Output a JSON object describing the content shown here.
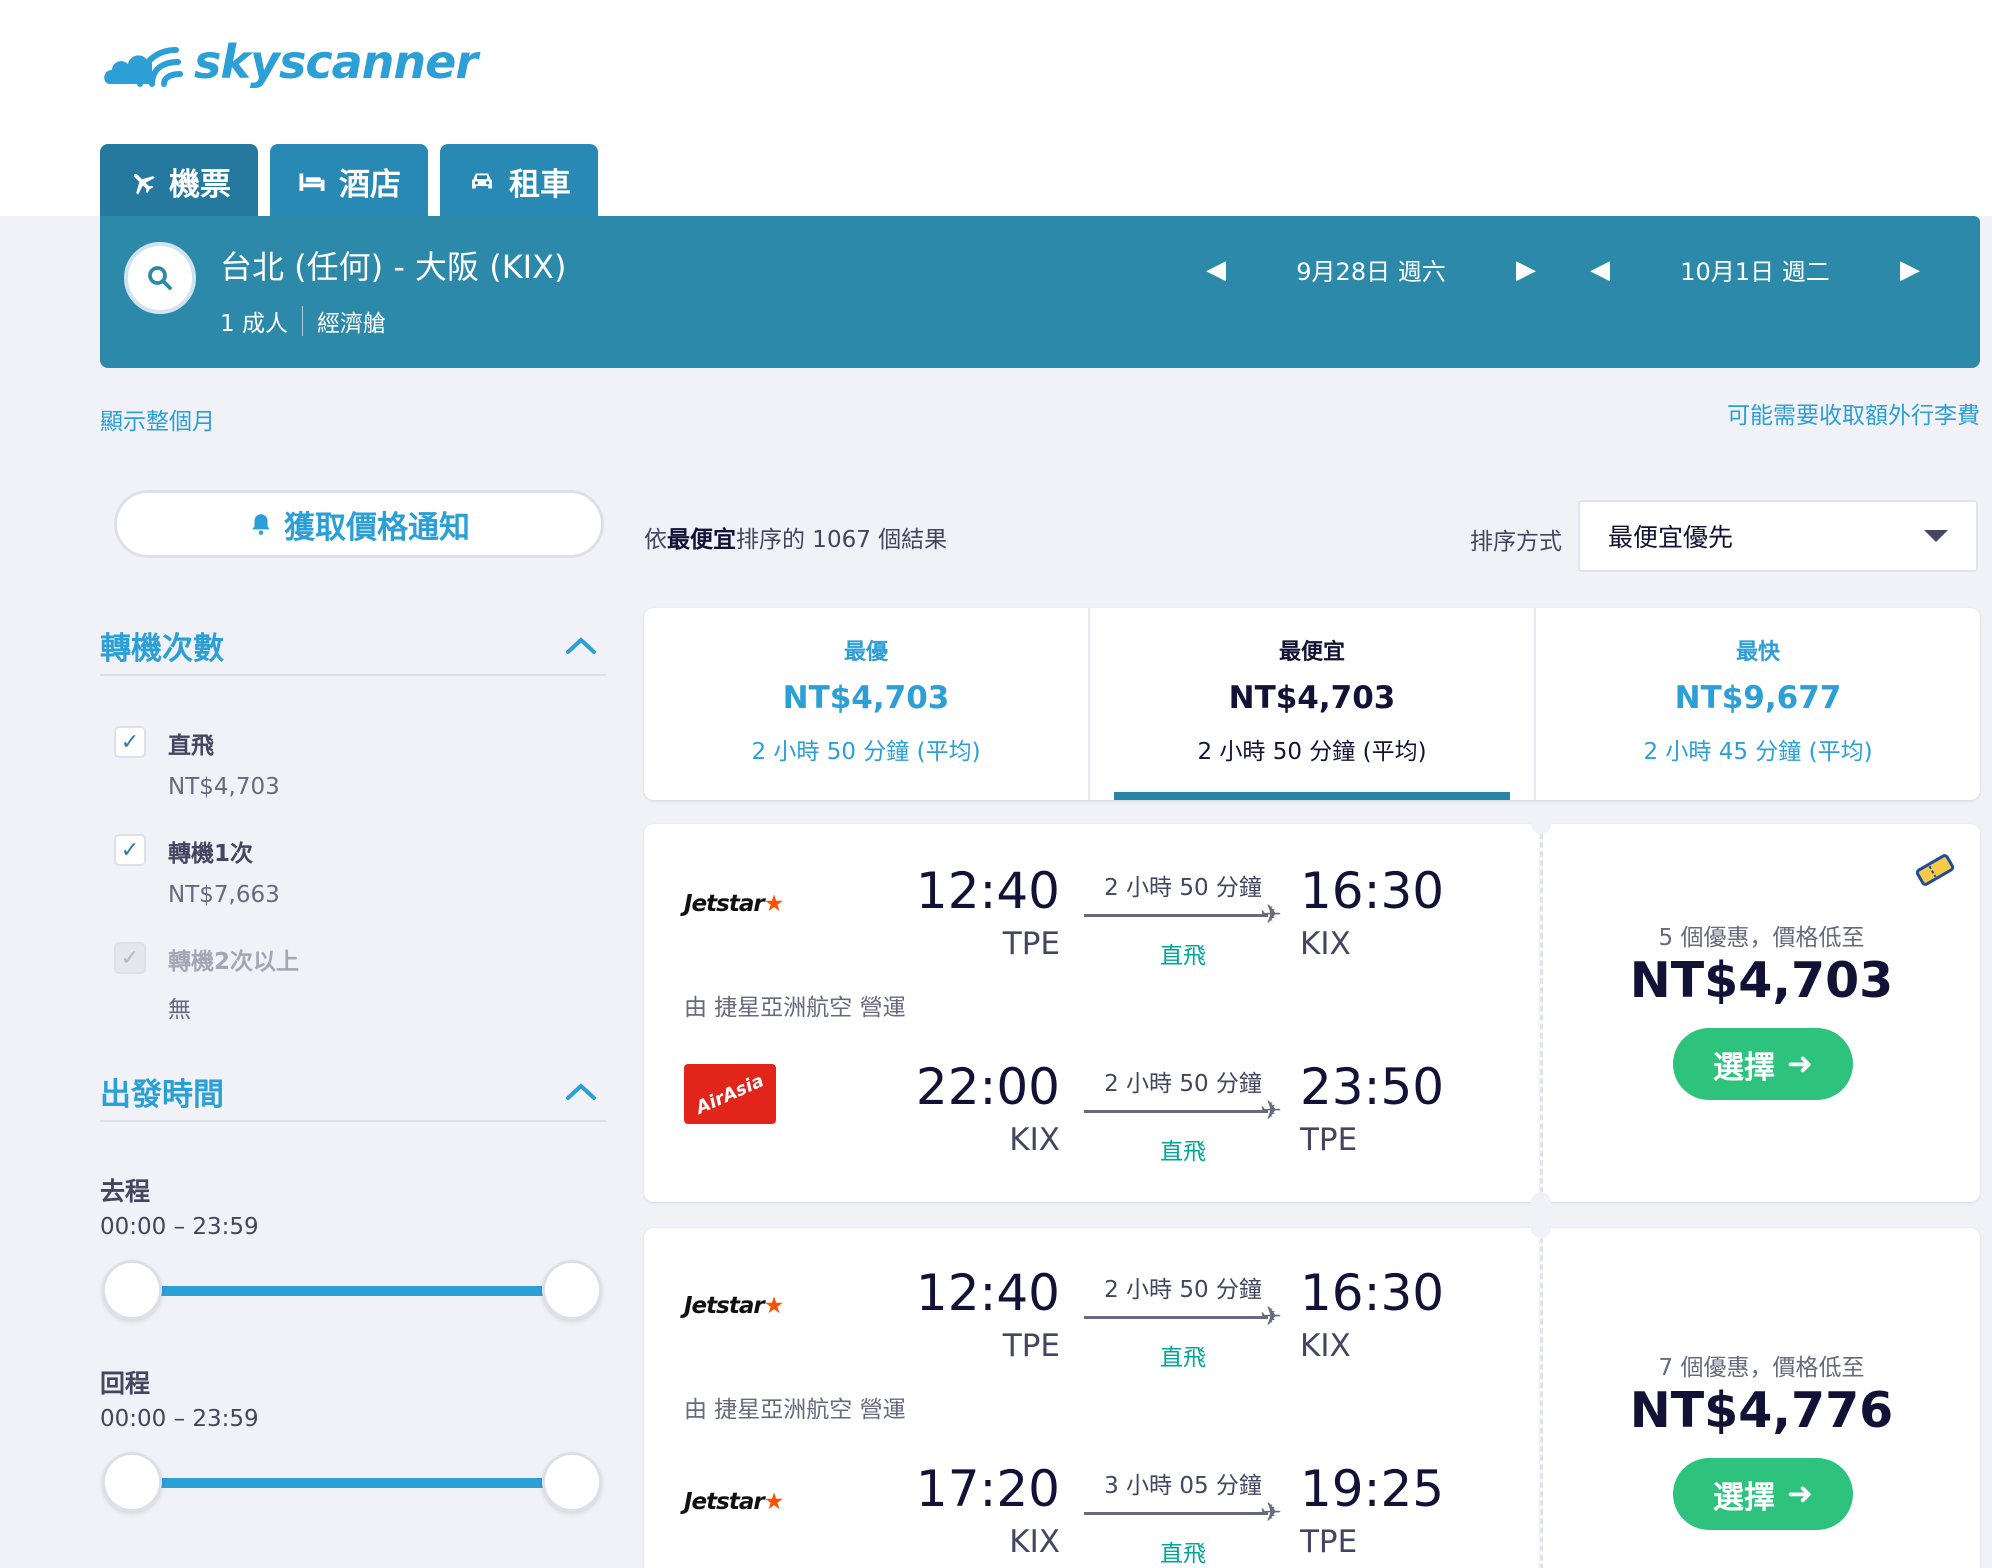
{
  "brand": {
    "name": "skyscanner"
  },
  "tabs": [
    {
      "label": "機票",
      "icon": "plane-icon",
      "active": true
    },
    {
      "label": "酒店",
      "icon": "bed-icon",
      "active": false
    },
    {
      "label": "租車",
      "icon": "car-icon",
      "active": false
    }
  ],
  "search": {
    "route": "台北 (任何) - 大阪 (KIX)",
    "passengers": "1 成人",
    "cabin": "經濟艙",
    "depart_date": "9月28日 週六",
    "return_date": "10月1日 週二"
  },
  "links": {
    "show_month": "顯示整個月",
    "baggage_fee": "可能需要收取額外行李費"
  },
  "price_alert": {
    "label": "獲取價格通知"
  },
  "filters": {
    "stops": {
      "title": "轉機次數",
      "options": [
        {
          "label": "直飛",
          "price": "NT$4,703",
          "checked": true,
          "disabled": false
        },
        {
          "label": "轉機1次",
          "price": "NT$7,663",
          "checked": true,
          "disabled": false
        },
        {
          "label": "轉機2次以上",
          "price": "無",
          "checked": true,
          "disabled": true
        }
      ]
    },
    "departure_time": {
      "title": "出發時間",
      "outbound": {
        "label": "去程",
        "range": "00:00 – 23:59"
      },
      "inbound": {
        "label": "回程",
        "range": "00:00 – 23:59"
      }
    }
  },
  "results": {
    "prefix": "依",
    "sort_word": "最便宜",
    "suffix": "排序的 1067 個結果"
  },
  "sort": {
    "label": "排序方式",
    "selected": "最便宜優先"
  },
  "summary": [
    {
      "label": "最優",
      "price": "NT$4,703",
      "duration": "2 小時 50 分鐘 (平均)"
    },
    {
      "label": "最便宜",
      "price": "NT$4,703",
      "duration": "2 小時 50 分鐘 (平均)"
    },
    {
      "label": "最快",
      "price": "NT$9,677",
      "duration": "2 小時 45 分鐘 (平均)"
    }
  ],
  "flights": [
    {
      "outbound": {
        "airline": "Jetstar",
        "dep_time": "12:40",
        "dep_code": "TPE",
        "duration": "2 小時 50 分鐘",
        "stops": "直飛",
        "arr_time": "16:30",
        "arr_code": "KIX"
      },
      "operated_by": "由 捷星亞洲航空 營運",
      "inbound": {
        "airline": "AirAsia",
        "dep_time": "22:00",
        "dep_code": "KIX",
        "duration": "2 小時 50 分鐘",
        "stops": "直飛",
        "arr_time": "23:50",
        "arr_code": "TPE"
      },
      "deals": "5 個優惠，價格低至",
      "price": "NT$4,703",
      "select_label": "選擇"
    },
    {
      "outbound": {
        "airline": "Jetstar",
        "dep_time": "12:40",
        "dep_code": "TPE",
        "duration": "2 小時 50 分鐘",
        "stops": "直飛",
        "arr_time": "16:30",
        "arr_code": "KIX"
      },
      "operated_by": "由 捷星亞洲航空 營運",
      "inbound": {
        "airline": "Jetstar",
        "dep_time": "17:20",
        "dep_code": "KIX",
        "duration": "3 小時 05 分鐘",
        "stops": "直飛",
        "arr_time": "19:25",
        "arr_code": "TPE"
      },
      "deals": "7 個優惠，價格低至",
      "price": "NT$4,776",
      "select_label": "選擇"
    }
  ],
  "colors": {
    "brand_blue": "#2b9fd6",
    "search_bar": "#2d89aa",
    "select_green": "#2ec37c",
    "direct_green": "#00a698"
  }
}
